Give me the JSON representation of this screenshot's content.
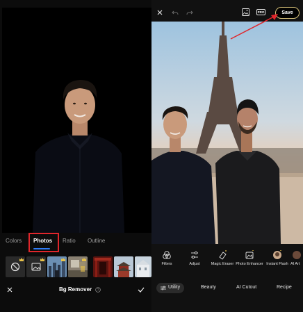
{
  "left_panel": {
    "tabs": [
      {
        "label": "Colors"
      },
      {
        "label": "Photos"
      },
      {
        "label": "Ratio"
      },
      {
        "label": "Outline"
      }
    ],
    "thumbnails": [
      {
        "kind": "none",
        "icon": "no-background-icon",
        "premium": true
      },
      {
        "kind": "image-placeholder",
        "icon": "image-icon",
        "premium": true
      },
      {
        "kind": "photo",
        "scene": "city-skyline",
        "premium": true
      },
      {
        "kind": "photo",
        "scene": "room",
        "premium": true
      },
      {
        "kind": "photo",
        "scene": "red-theater"
      },
      {
        "kind": "photo",
        "scene": "pagoda"
      },
      {
        "kind": "photo",
        "scene": "white-building"
      }
    ],
    "bottom": {
      "title": "Bg Remover",
      "help_icon": "question-circle-icon",
      "close_icon": "close-icon",
      "confirm_icon": "checkmark-icon"
    }
  },
  "right_panel": {
    "topbar": {
      "icons": [
        "close-icon",
        "undo-icon",
        "redo-icon",
        "gallery-icon",
        "pro-badge-icon"
      ],
      "pro_label": "PRO",
      "save_label": "Save"
    },
    "tools": [
      {
        "label": "Filters",
        "icon": "filters-icon"
      },
      {
        "label": "Adjust",
        "icon": "sliders-icon"
      },
      {
        "label": "Magic Eraser",
        "icon": "eraser-icon",
        "premium": true
      },
      {
        "label": "Photo Enhancer",
        "icon": "enhance-photo-icon",
        "premium": true
      },
      {
        "label": "Instant Flash",
        "icon": "flash-avatar-icon",
        "premium": true
      },
      {
        "label": "AI Art",
        "icon": "ai-art-icon"
      }
    ],
    "bottom_tabs": [
      {
        "label": "Utility",
        "active": true,
        "icon": "utility-sliders-icon"
      },
      {
        "label": "Beauty"
      },
      {
        "label": "AI Cutout"
      },
      {
        "label": "Recipe"
      }
    ]
  },
  "colors": {
    "accent_blue": "#2f7cf6",
    "highlight_red": "#e0262b",
    "premium_gold": "#e8c24a",
    "save_border": "#d8c27a"
  }
}
